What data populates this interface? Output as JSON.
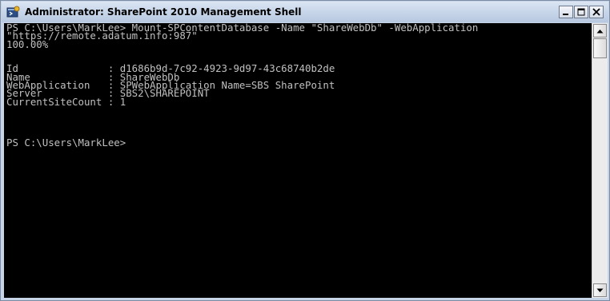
{
  "window": {
    "title": "Administrator: SharePoint 2010 Management Shell",
    "icon": "powershell-shell-icon",
    "controls": [
      "minimize-icon",
      "maximize-icon",
      "close-icon"
    ]
  },
  "console": {
    "lines": [
      "PS C:\\Users\\MarkLee> Mount-SPContentDatabase -Name \"ShareWebDb\" -WebApplication",
      "\"https://remote.adatum.info:987\"",
      "100.00%",
      "",
      "",
      "Id               : d1686b9d-7c92-4923-9d97-43c68740b2de",
      "Name             : ShareWebDb",
      "WebApplication   : SPWebApplication Name=SBS SharePoint",
      "Server           : SBS2\\SHAREPOINT",
      "CurrentSiteCount : 1",
      "",
      "",
      "",
      "",
      "PS C:\\Users\\MarkLee>",
      "",
      "",
      "",
      "",
      "",
      "",
      "",
      "",
      "",
      "",
      "",
      "",
      "",
      "",
      "",
      "",
      "",
      ""
    ]
  },
  "scrollbar": {
    "up_icon": "arrow-up-icon",
    "down_icon": "arrow-down-icon"
  }
}
